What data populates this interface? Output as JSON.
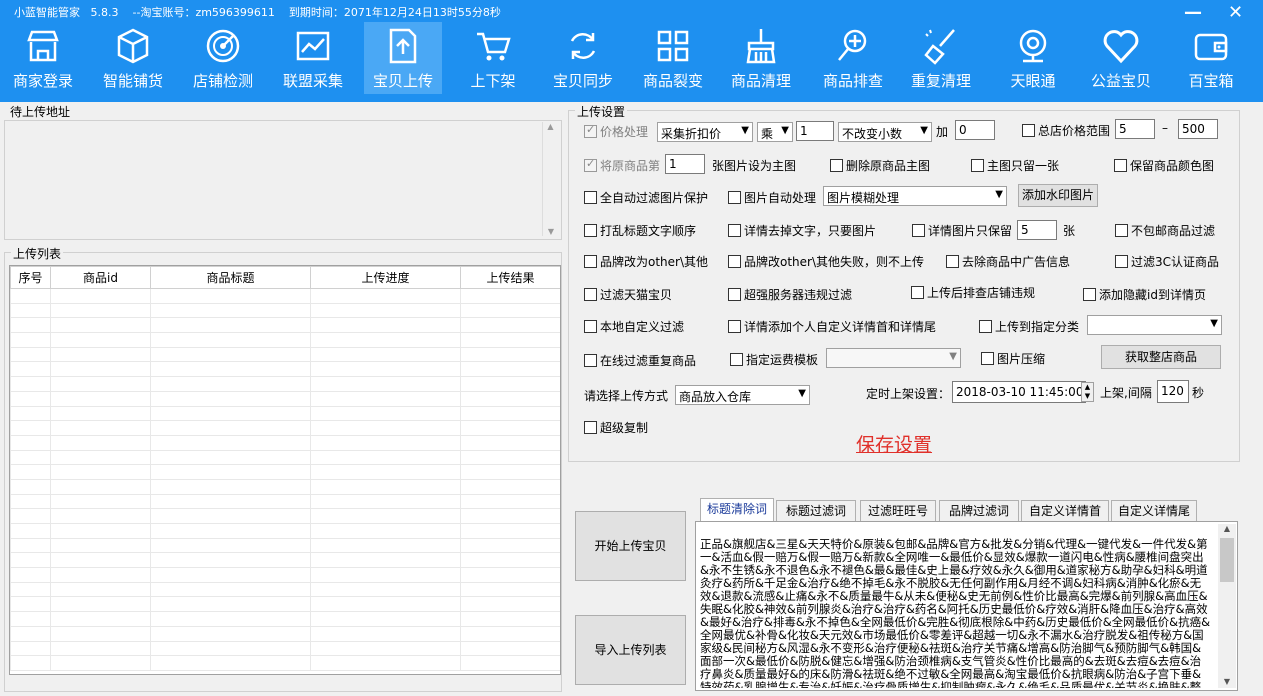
{
  "title": {
    "app": "小蓝智能管家",
    "version": "5.8.3",
    "account": "--淘宝账号：zm596399611",
    "expire": "到期时间：2071年12月24日13时55分8秒"
  },
  "window": {
    "minimize": "—",
    "close": "✕"
  },
  "nav": [
    {
      "label": "商家登录",
      "icon": "store"
    },
    {
      "label": "智能铺货",
      "icon": "box"
    },
    {
      "label": "店铺检测",
      "icon": "radar"
    },
    {
      "label": "联盟采集",
      "icon": "chart"
    },
    {
      "label": "宝贝上传",
      "icon": "upload"
    },
    {
      "label": "上下架",
      "icon": "cart"
    },
    {
      "label": "宝贝同步",
      "icon": "sync"
    },
    {
      "label": "商品裂变",
      "icon": "grid"
    },
    {
      "label": "商品清理",
      "icon": "broom"
    },
    {
      "label": "商品排查",
      "icon": "search"
    },
    {
      "label": "重复清理",
      "icon": "sweep"
    },
    {
      "label": "天眼通",
      "icon": "camera"
    },
    {
      "label": "公益宝贝",
      "icon": "heart"
    },
    {
      "label": "百宝箱",
      "icon": "wallet"
    }
  ],
  "active_nav": "宝贝上传",
  "pending": {
    "title": "待上传地址"
  },
  "upload_list": {
    "title": "上传列表",
    "columns": [
      "序号",
      "商品id",
      "商品标题",
      "上传进度",
      "上传结果"
    ]
  },
  "settings": {
    "title": "上传设置",
    "price": {
      "label": "价格处理",
      "mode": "采集折扣价",
      "op": "乘",
      "factor": "1",
      "rounding": "不改变小数",
      "plus_label": "加",
      "plus": "0",
      "range_label": "总店价格范围",
      "min": "5",
      "dash": "–",
      "max": "500"
    },
    "main_img": {
      "label": "将原商品第",
      "value": "1",
      "suffix": "张图片设为主图",
      "delete_label": "删除原商品主图",
      "keep_one_label": "主图只留一张",
      "keep_color_label": "保留商品颜色图"
    },
    "auto_filter_img": "全自动过滤图片保护",
    "img_auto": {
      "label": "图片自动处理",
      "value": "图片模糊处理",
      "button": "添加水印图片"
    },
    "row4": {
      "shuffle": "打乱标题文字顺序",
      "desc_img_only": "详情去掉文字，只要图片",
      "keep_detail": "详情图片只保留",
      "keep_detail_value": "5",
      "unit": "张",
      "no_free_ship": "不包邮商品过滤"
    },
    "row5": {
      "brand_other": "品牌改为other\\其他",
      "brand_fail": "品牌改other\\其他失败，则不上传",
      "remove_ads": "去除商品中广告信息",
      "filter_3c": "过滤3C认证商品"
    },
    "row6": {
      "filter_tmall": "过滤天猫宝贝",
      "filter_violation": "超强服务器违规过滤",
      "check_after": "上传后排查店铺违规",
      "add_hidden_id": "添加隐藏id到详情页"
    },
    "row7": {
      "local_filter": "本地自定义过滤",
      "custom_detail": "详情添加个人自定义详情首和详情尾",
      "to_category": "上传到指定分类",
      "category": ""
    },
    "row8": {
      "online_dup": "在线过滤重复商品",
      "ship_template": "指定运费模板",
      "ship_value": "",
      "compress": "图片压缩",
      "get_shop": "获取整店商品"
    },
    "method": {
      "label": "请选择上传方式",
      "value": "商品放入仓库",
      "timer_label": "定时上架设置：",
      "timer": "2018-03-10 11:45:00",
      "interval_label": "上架,间隔",
      "interval": "120",
      "sec": "秒"
    },
    "super_copy": "超级复制",
    "save": "保存设置"
  },
  "buttons": {
    "start": "开始上传宝贝",
    "import": "导入上传列表"
  },
  "tabs": [
    "标题清除词",
    "标题过滤词",
    "过滤旺旺号",
    "品牌过滤词",
    "自定义详情首",
    "自定义详情尾"
  ],
  "active_tab": "标题清除词",
  "wordlist": "正品&旗舰店&三星&天天特价&原装&包邮&品牌&官方&批发&分销&代理&一键代发&一件代发&第一&活血&假一赔万&假一赔万&新款&全网唯一&最低价&显效&爆款一道闪电&性病&腰椎间盘突出&永不生锈&永不退色&永不褪色&最&最佳&史上最&疗效&永久&御用&道家秘方&助孕&妇科&明道灸疗&药所&千足金&治疗&绝不掉毛&永不脱胶&无任何副作用&月经不调&妇科病&消肿&化瘀&无效&退款&流感&止痛&永不&质量最牛&从未&便秘&史无前例&性价比最高&完爆&前列腺&高血压&失眠&化胶&神效&前列腺炎&治疗&治疗&药名&阿托&历史最低价&疗效&消肝&降血压&治疗&高效&最好&治疗&排毒&永不掉色&全网最低价&完胜&彻底根除&中药&历史最低价&全网最低价&抗癌&全网最优&补骨&化妆&天元效&市场最低价&零差评&超越一切&永不漏水&治疗脱发&祖传秘方&国家级&民间秘方&风湿&永不变形&治疗便秘&祛斑&治疗关节痛&增高&防治脚气&预防脚气&韩国&面部一次&最低价&防脱&健忘&增强&防治颈椎病&支气管炎&性价比最高的&去斑&去痘&去痘&治疗鼻炎&质量最好&的床&防滑&祛斑&绝不过敏&全网最高&淘宝最低价&抗眼病&防治&子宫下垂&特效药&乳腺增生&专治&妊娠&治疗骨质增生&抑制肿瘤&永久&绝毛&品质最优&关节炎&换肤&整形&治疗感冒&永不下垂&永不褪色&痘疤&永效&最好&历史最"
}
